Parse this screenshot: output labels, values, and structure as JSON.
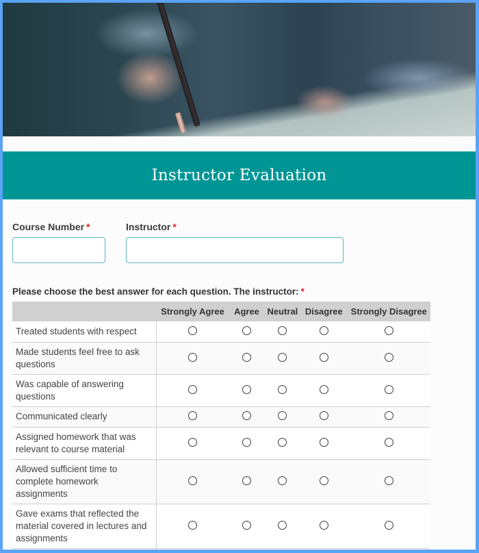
{
  "form": {
    "title": "Instructor Evaluation",
    "accent_color": "#009595",
    "frame_color": "#5ba3f5",
    "fields": [
      {
        "label": "Course Number",
        "required_mark": "*",
        "value": "",
        "placeholder": ""
      },
      {
        "label": "Instructor",
        "required_mark": "*",
        "value": "",
        "placeholder": ""
      }
    ],
    "matrix": {
      "question": "Please choose the best answer for each question. The instructor:",
      "required_mark": "*",
      "columns": [
        "Strongly Agree",
        "Agree",
        "Neutral",
        "Disagree",
        "Strongly Disagree"
      ],
      "rows": [
        "Treated students with respect",
        "Made students feel free to ask questions",
        "Was capable of answering questions",
        "Communicated clearly",
        "Assigned homework that was relevant to course material",
        "Allowed sufficient time to complete homework assignments",
        "Gave exams that reflected the material covered in lectures and assignments"
      ]
    }
  }
}
